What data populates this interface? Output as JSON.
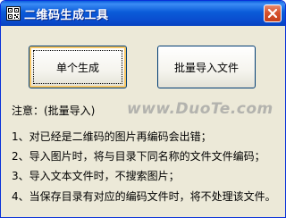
{
  "window": {
    "title": "二维码生成工具",
    "icon": "qr-code-icon",
    "close_icon": "close-icon"
  },
  "buttons": {
    "single_label": "单个生成",
    "batch_label": "批量导入文件"
  },
  "notes": {
    "heading": "注意：(批量导入)",
    "rules": [
      "1、对已经是二维码的图片再编码会出错；",
      "2、导入图片时，将与目录下同名称的文件文件编码；",
      "3、导入文本文件时，不搜索图片；",
      "4、当保存目录有对应的编码文件时，将不处理该文件。"
    ]
  },
  "watermark": {
    "text": "www.DuoTe.com"
  },
  "colors": {
    "titlebar": "#0a5ddd",
    "close_button": "#d6532f",
    "window_background": "#ece9d8",
    "button_border": "#003c74"
  }
}
